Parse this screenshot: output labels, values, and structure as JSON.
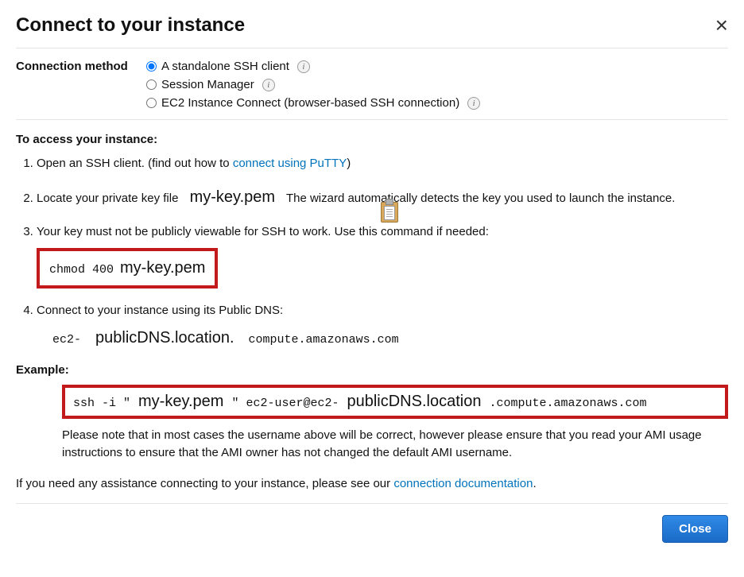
{
  "dialog": {
    "title": "Connect to your instance",
    "close_label": "Close"
  },
  "connection_method": {
    "label": "Connection method",
    "options": [
      {
        "label": "A standalone SSH client",
        "info": true,
        "checked": true
      },
      {
        "label": "Session Manager",
        "info": true,
        "checked": false
      },
      {
        "label": "EC2 Instance Connect (browser-based SSH connection)",
        "info": true,
        "checked": false
      }
    ]
  },
  "instructions": {
    "heading": "To access your instance:",
    "step1_a": "Open an SSH client. (find out how to ",
    "step1_link": "connect using PuTTY",
    "step1_b": ")",
    "step2_a": "Locate your private key file",
    "step2_key": "my-key.pem",
    "step2_b": "The wizard automatically detects the key you used to launch the instance.",
    "step3": "Your key must not be publicly viewable for SSH to work. Use this command if needed:",
    "step3_cmd_a": "chmod 400",
    "step3_cmd_b": "my-key.pem",
    "step4": "Connect to your instance using its Public DNS:",
    "step4_dns_a": "ec2-",
    "step4_dns_b": "publicDNS.location.",
    "step4_dns_c": "compute.amazonaws.com"
  },
  "example": {
    "heading": "Example:",
    "ssh_a": "ssh -i \"",
    "ssh_key": "my-key.pem",
    "ssh_b": "\" ec2-user@ec2-",
    "ssh_loc": "publicDNS.location",
    "ssh_c": ".compute.amazonaws.com",
    "note": "Please note that in most cases the username above will be correct, however please ensure that you read your AMI usage instructions to ensure that the AMI owner has not changed the default AMI username."
  },
  "footer": {
    "text_a": "If you need any assistance connecting to your instance, please see our ",
    "link": "connection documentation",
    "text_b": "."
  }
}
